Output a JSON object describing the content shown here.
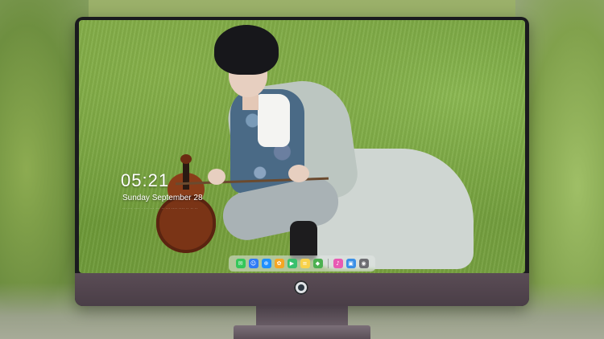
{
  "lockscreen": {
    "time": "05:21",
    "date": "Sunday September 28",
    "subtitle": "··· ··· ···· · ··· ··· ··· ·· ··· ···· ···· ·· ·· ··"
  },
  "dock": {
    "items": [
      {
        "name": "messages-icon",
        "color": "#34c759",
        "glyph": "✉"
      },
      {
        "name": "finder-icon",
        "color": "#2f7bf5",
        "glyph": "☺"
      },
      {
        "name": "safari-icon",
        "color": "#1e90ff",
        "glyph": "⊕"
      },
      {
        "name": "photos-icon",
        "color": "#f5a623",
        "glyph": "✿"
      },
      {
        "name": "facetime-icon",
        "color": "#39c06d",
        "glyph": "▶"
      },
      {
        "name": "notes-icon",
        "color": "#f8d24a",
        "glyph": "≡"
      },
      {
        "name": "maps-icon",
        "color": "#4cb050",
        "glyph": "◆"
      },
      {
        "name": "itunes-icon",
        "color": "#e85ab3",
        "glyph": "♪"
      },
      {
        "name": "preview-icon",
        "color": "#3a8fe6",
        "glyph": "▣"
      },
      {
        "name": "camera-icon",
        "color": "#6d6d72",
        "glyph": "◉"
      }
    ]
  },
  "monitor": {
    "logo_icon": "alien-logo-icon"
  }
}
